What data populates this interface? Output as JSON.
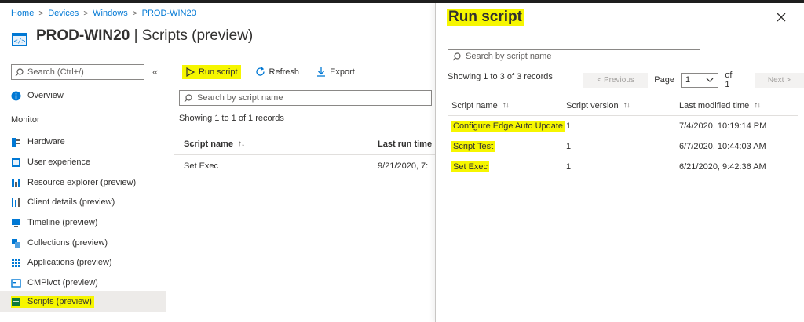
{
  "breadcrumb": [
    "Home",
    "Devices",
    "Windows",
    "PROD-WIN20"
  ],
  "page": {
    "device": "PROD-WIN20",
    "subtitle": "| Scripts (preview)"
  },
  "nav": {
    "search_placeholder": "Search (Ctrl+/)",
    "collapse": "«",
    "overview": "Overview",
    "section_monitor": "Monitor",
    "items": [
      "Hardware",
      "User experience",
      "Resource explorer (preview)",
      "Client details (preview)",
      "Timeline (preview)",
      "Collections (preview)",
      "Applications (preview)",
      "CMPivot (preview)",
      "Scripts (preview)"
    ]
  },
  "toolbar": {
    "run_script": "Run script",
    "refresh": "Refresh",
    "export": "Export"
  },
  "main": {
    "search_placeholder": "Search by script name",
    "count": "Showing 1 to 1 of 1 records",
    "columns": [
      "Script name",
      "Last run time"
    ],
    "rows": [
      {
        "name": "Set Exec",
        "last_run": "9/21/2020, 7:"
      }
    ]
  },
  "panel": {
    "title": "Run script",
    "search_placeholder": "Search by script name",
    "count": "Showing 1 to 3 of 3 records",
    "pager": {
      "previous": "< Previous",
      "page_label": "Page",
      "page_value": "1",
      "of": "of 1",
      "next": "Next >"
    },
    "columns": [
      "Script name",
      "Script version",
      "Last modified time"
    ],
    "rows": [
      {
        "name": "Configure Edge Auto Update",
        "version": "1",
        "modified": "7/4/2020, 10:19:14 PM"
      },
      {
        "name": "Script Test",
        "version": "1",
        "modified": "6/7/2020, 10:44:03 AM"
      },
      {
        "name": "Set Exec",
        "version": "1",
        "modified": "6/21/2020, 9:42:36 AM"
      }
    ]
  },
  "colors": {
    "accent": "#0078d4",
    "highlight": "#f6f600",
    "border": "#8a8886"
  }
}
